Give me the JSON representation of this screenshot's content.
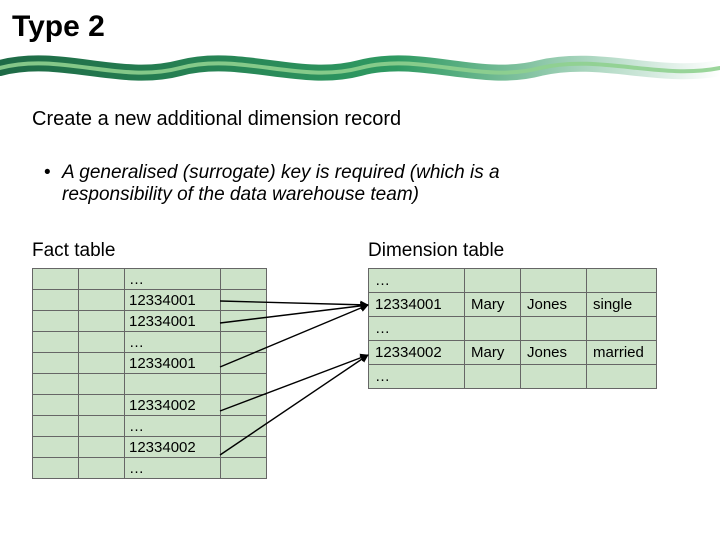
{
  "title": "Type 2",
  "subtitle": "Create a new additional dimension record",
  "bullet": {
    "line1": "A generalised (surrogate) key is required (which is a",
    "line2": "responsibility of the data warehouse team)"
  },
  "labels": {
    "fact": "Fact table",
    "dim": "Dimension table"
  },
  "fact_rows": [
    "…",
    "12334001",
    "12334001",
    "…",
    "12334001",
    "",
    "12334002",
    "…",
    "12334002",
    "…"
  ],
  "dim_rows": [
    {
      "k": "…",
      "fn": "",
      "ln": "",
      "st": ""
    },
    {
      "k": "12334001",
      "fn": "Mary",
      "ln": "Jones",
      "st": "single"
    },
    {
      "k": "…",
      "fn": "",
      "ln": "",
      "st": ""
    },
    {
      "k": "12334002",
      "fn": "Mary",
      "ln": "Jones",
      "st": "married"
    },
    {
      "k": "…",
      "fn": "",
      "ln": "",
      "st": ""
    }
  ]
}
